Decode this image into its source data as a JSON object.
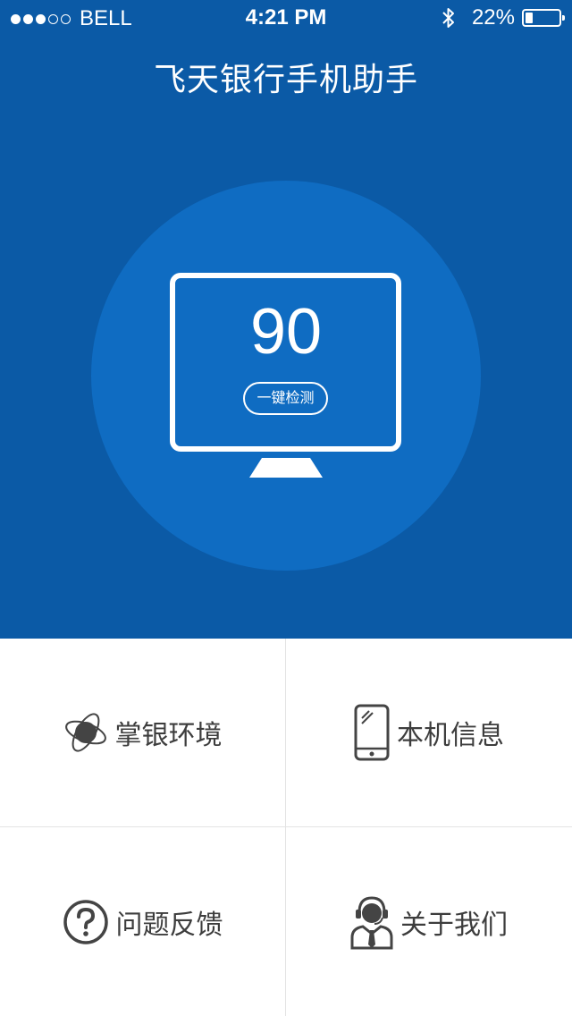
{
  "status_bar": {
    "signal_dots_filled": 3,
    "signal_dots_total": 5,
    "carrier": "BELL",
    "time": "4:21 PM",
    "bluetooth_icon": "bluetooth-icon",
    "battery_percent": "22%",
    "battery_level": 0.22
  },
  "header": {
    "title": "飞天银行手机助手"
  },
  "hero": {
    "score": "90",
    "check_button_label": "一键检测",
    "monitor_icon": "monitor-icon"
  },
  "menu": {
    "items": [
      {
        "label": "掌银环境",
        "icon": "planet-icon"
      },
      {
        "label": "本机信息",
        "icon": "phone-icon"
      },
      {
        "label": "问题反馈",
        "icon": "question-icon"
      },
      {
        "label": "关于我们",
        "icon": "support-agent-icon"
      }
    ]
  },
  "colors": {
    "header_bg": "#0b5aa6",
    "circle_bg": "#0f6cc2",
    "text_dark": "#3d3d3d",
    "divider": "#e3e3e3"
  }
}
